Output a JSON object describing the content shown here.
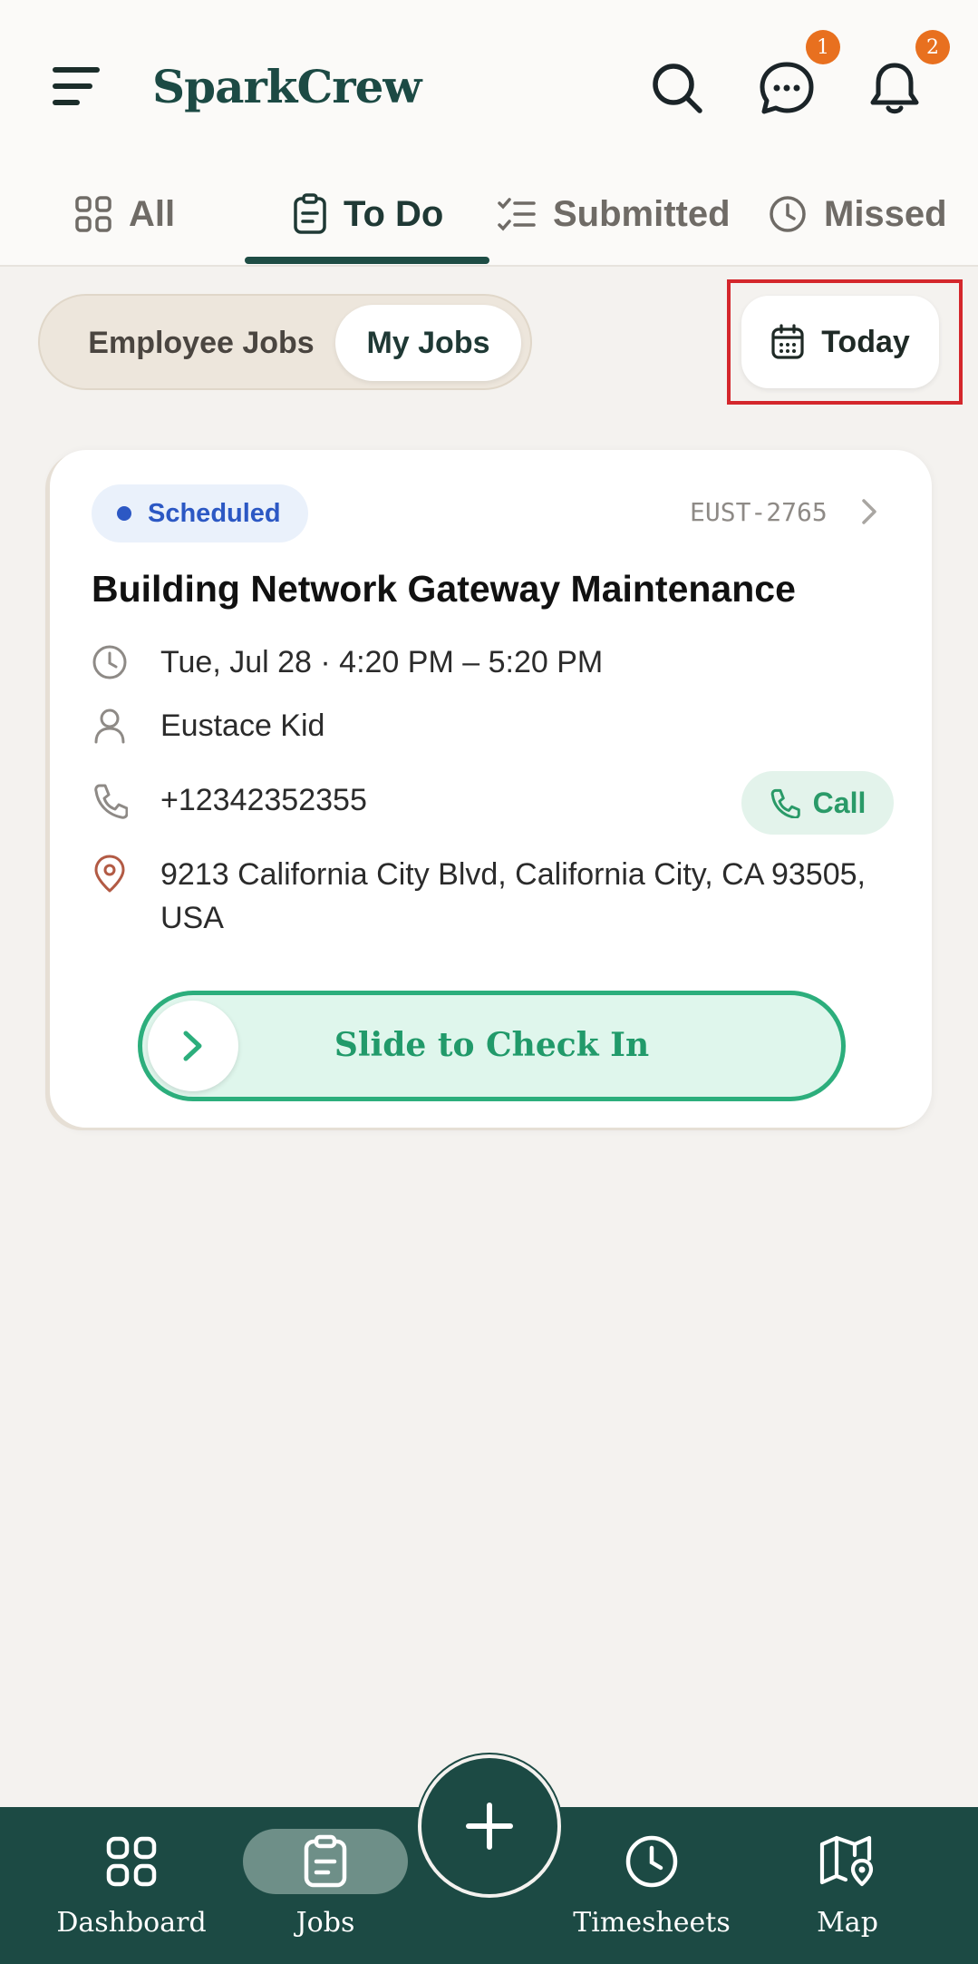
{
  "header": {
    "brand": "SparkCrew",
    "messages_badge": "1",
    "notifications_badge": "2"
  },
  "tabs": [
    {
      "label": "All",
      "icon": "grid-icon"
    },
    {
      "label": "To Do",
      "icon": "clipboard-icon",
      "active": true
    },
    {
      "label": "Submitted",
      "icon": "checklist-icon"
    },
    {
      "label": "Missed",
      "icon": "clock-icon"
    }
  ],
  "filter": {
    "employee_jobs": "Employee Jobs",
    "my_jobs": "My Jobs",
    "active": "My Jobs",
    "date": "Today"
  },
  "job": {
    "status": "Scheduled",
    "code": "EUST-2765",
    "title": "Building Network Gateway Maintenance",
    "datetime": "Tue, Jul 28 · 4:20 PM – 5:20 PM",
    "customer": "Eustace Kid",
    "phone": "+12342352355",
    "call_label": "Call",
    "address": "9213 California City Blvd, California City, CA 93505, USA",
    "slide_label": "Slide to Check In"
  },
  "bottom_nav": [
    {
      "label": "Dashboard",
      "icon": "dashboard-icon"
    },
    {
      "label": "Jobs",
      "icon": "jobs-icon",
      "active": true
    },
    {
      "label": "Timesheets",
      "icon": "clock-icon"
    },
    {
      "label": "Map",
      "icon": "map-icon"
    }
  ],
  "colors": {
    "brand": "#1c4a44",
    "accent_green": "#2cae7c",
    "badge": "#e8701f",
    "status_blue": "#2c58c4"
  }
}
